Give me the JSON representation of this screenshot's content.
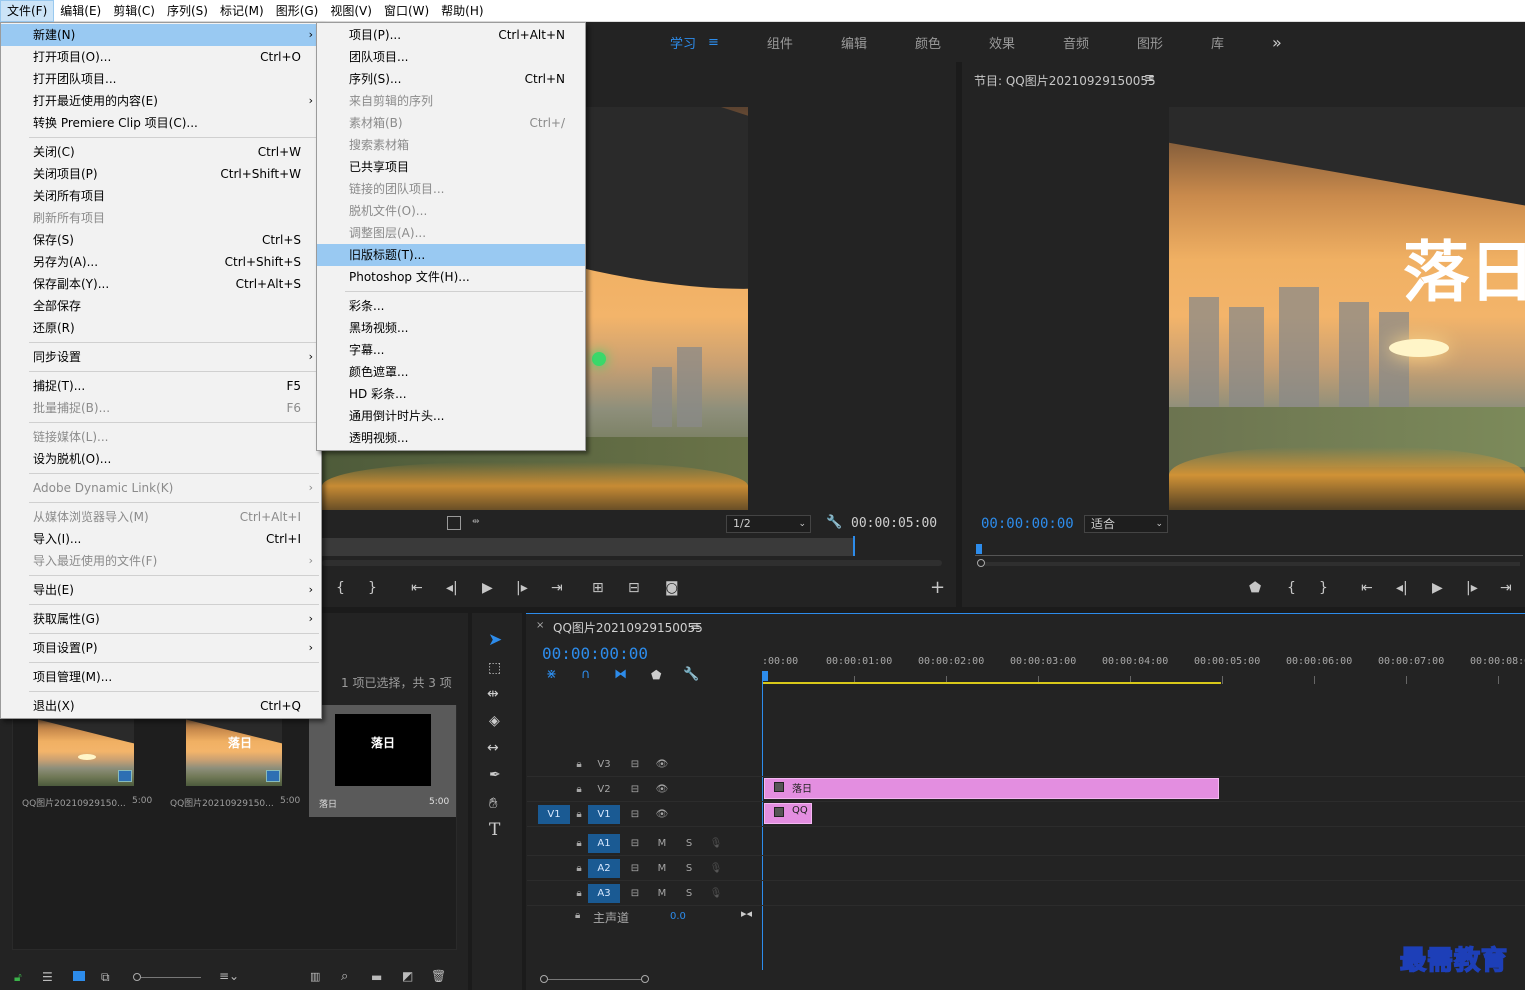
{
  "menubar": [
    "文件(F)",
    "编辑(E)",
    "剪辑(C)",
    "序列(S)",
    "标记(M)",
    "图形(G)",
    "视图(V)",
    "窗口(W)",
    "帮助(H)"
  ],
  "workspaces": [
    "学习",
    "组件",
    "编辑",
    "颜色",
    "效果",
    "音频",
    "图形",
    "库"
  ],
  "workspace_more": "»",
  "file_menu": [
    {
      "label": "新建(N)",
      "sub": true,
      "hl": true
    },
    {
      "label": "打开项目(O)...",
      "sc": "Ctrl+O"
    },
    {
      "label": "打开团队项目..."
    },
    {
      "label": "打开最近使用的内容(E)",
      "sub": true
    },
    {
      "label": "转换 Premiere Clip 项目(C)..."
    },
    {
      "sep": true
    },
    {
      "label": "关闭(C)",
      "sc": "Ctrl+W"
    },
    {
      "label": "关闭项目(P)",
      "sc": "Ctrl+Shift+W"
    },
    {
      "label": "关闭所有项目"
    },
    {
      "label": "刷新所有项目",
      "dis": true
    },
    {
      "label": "保存(S)",
      "sc": "Ctrl+S"
    },
    {
      "label": "另存为(A)...",
      "sc": "Ctrl+Shift+S"
    },
    {
      "label": "保存副本(Y)...",
      "sc": "Ctrl+Alt+S"
    },
    {
      "label": "全部保存"
    },
    {
      "label": "还原(R)"
    },
    {
      "sep": true
    },
    {
      "label": "同步设置",
      "sub": true
    },
    {
      "sep": true
    },
    {
      "label": "捕捉(T)...",
      "sc": "F5"
    },
    {
      "label": "批量捕捉(B)...",
      "sc": "F6",
      "dis": true
    },
    {
      "sep": true
    },
    {
      "label": "链接媒体(L)...",
      "dis": true
    },
    {
      "label": "设为脱机(O)..."
    },
    {
      "sep": true
    },
    {
      "label": "Adobe Dynamic Link(K)",
      "sub": true,
      "dis": true
    },
    {
      "sep": true
    },
    {
      "label": "从媒体浏览器导入(M)",
      "sc": "Ctrl+Alt+I",
      "dis": true
    },
    {
      "label": "导入(I)...",
      "sc": "Ctrl+I"
    },
    {
      "label": "导入最近使用的文件(F)",
      "sub": true,
      "dis": true
    },
    {
      "sep": true
    },
    {
      "label": "导出(E)",
      "sub": true
    },
    {
      "sep": true
    },
    {
      "label": "获取属性(G)",
      "sub": true
    },
    {
      "sep": true
    },
    {
      "label": "项目设置(P)",
      "sub": true
    },
    {
      "sep": true
    },
    {
      "label": "项目管理(M)..."
    },
    {
      "sep": true
    },
    {
      "label": "退出(X)",
      "sc": "Ctrl+Q"
    }
  ],
  "new_menu": [
    {
      "label": "项目(P)...",
      "sc": "Ctrl+Alt+N"
    },
    {
      "label": "团队项目..."
    },
    {
      "label": "序列(S)...",
      "sc": "Ctrl+N"
    },
    {
      "label": "来自剪辑的序列",
      "dis": true
    },
    {
      "label": "素材箱(B)",
      "sc": "Ctrl+/",
      "dis": true
    },
    {
      "label": "搜索素材箱",
      "dis": true
    },
    {
      "label": "已共享项目"
    },
    {
      "label": "链接的团队项目...",
      "dis": true
    },
    {
      "label": "脱机文件(O)...",
      "dis": true
    },
    {
      "label": "调整图层(A)...",
      "dis": true
    },
    {
      "label": "旧版标题(T)...",
      "hl": true
    },
    {
      "label": "Photoshop 文件(H)..."
    },
    {
      "sep": true
    },
    {
      "label": "彩条..."
    },
    {
      "label": "黑场视频..."
    },
    {
      "label": "字幕..."
    },
    {
      "label": "颜色遮罩..."
    },
    {
      "label": "HD 彩条..."
    },
    {
      "label": "通用倒计时片头..."
    },
    {
      "label": "透明视频..."
    }
  ],
  "source": {
    "zoom": "1/2",
    "timecode": "00:00:05:00"
  },
  "program": {
    "title": "节目: QQ图片20210929150055",
    "timecode": "00:00:00:00",
    "fit": "适合",
    "overlay_text": "落日"
  },
  "project": {
    "status": "1 项已选择，共 3 项",
    "items": [
      {
        "name": "QQ图片20210929150...",
        "dur": "5:00"
      },
      {
        "name": "QQ图片20210929150...",
        "dur": "5:00",
        "overlay": "落日"
      },
      {
        "name": "落日",
        "dur": "5:00",
        "title": "落日"
      }
    ]
  },
  "timeline": {
    "tab": "QQ图片20210929150055",
    "timecode": "00:00:00:00",
    "ruler": [
      ":00:00",
      "00:00:01:00",
      "00:00:02:00",
      "00:00:03:00",
      "00:00:04:00",
      "00:00:05:00",
      "00:00:06:00",
      "00:00:07:00",
      "00:00:08:00"
    ],
    "video_tracks": [
      "V3",
      "V2",
      "V1"
    ],
    "source_patch": "V1",
    "audio_tracks": [
      "A1",
      "A2",
      "A3"
    ],
    "mix": {
      "label": "主声道",
      "value": "0.0"
    },
    "clips": [
      {
        "name": "落日"
      },
      {
        "name": "QQ"
      }
    ],
    "m_label": "M",
    "s_label": "S"
  },
  "watermark": "最需教育",
  "colors": {
    "accent": "#2d8ceb",
    "clip": "#e38ee0",
    "menu_hl": "#99c9f2"
  }
}
